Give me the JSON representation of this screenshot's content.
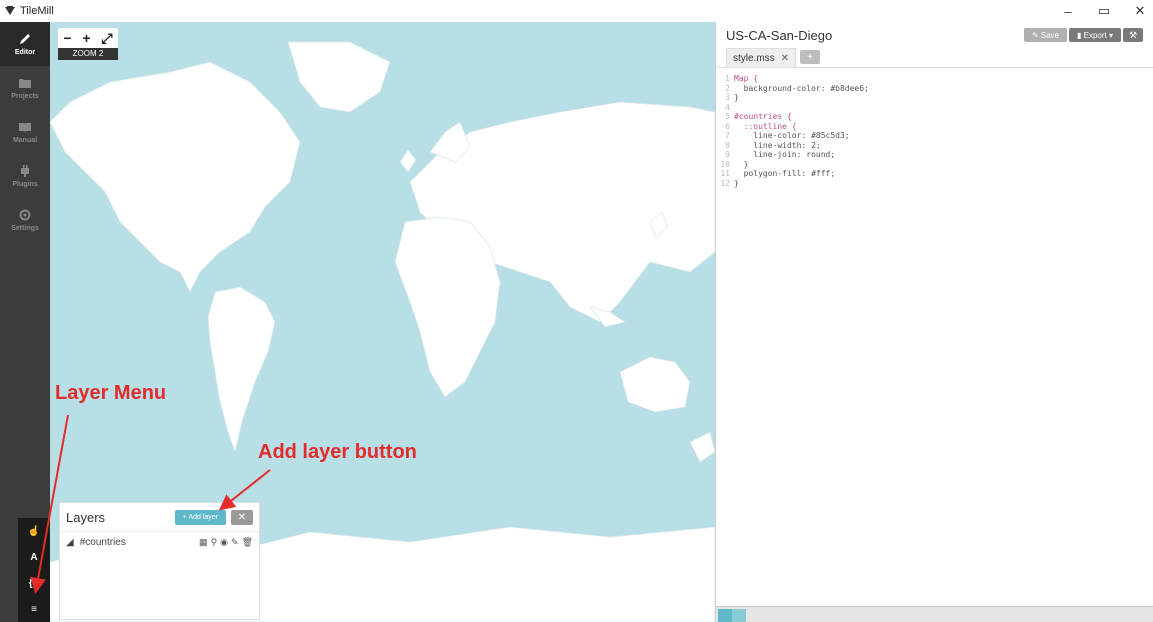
{
  "window": {
    "title": "TileMill",
    "controls": {
      "minimize": "–",
      "restore": "▭",
      "close": "✕"
    }
  },
  "sidebar": {
    "items": [
      {
        "label": "Editor",
        "icon": "pencil-icon",
        "active": true
      },
      {
        "label": "Projects",
        "icon": "folder-icon",
        "active": false
      },
      {
        "label": "Manual",
        "icon": "book-icon",
        "active": false
      },
      {
        "label": "Plugins",
        "icon": "plug-icon",
        "active": false
      },
      {
        "label": "Settings",
        "icon": "gear-icon",
        "active": false
      }
    ],
    "tools": [
      {
        "glyph": "☝",
        "icon": "hand-icon"
      },
      {
        "glyph": "A",
        "icon": "font-icon"
      },
      {
        "glyph": "{ }",
        "icon": "braces-icon"
      },
      {
        "glyph": "≡",
        "icon": "layers-icon"
      }
    ]
  },
  "map": {
    "zoom_label": "ZOOM 2",
    "zoom_in": "+",
    "zoom_out": "−",
    "fullscreen": "⤢",
    "background": "#b8dee6"
  },
  "annotations": {
    "layer_menu": "Layer Menu",
    "add_layer_button": "Add layer button",
    "color": "#e42b2b"
  },
  "layers_panel": {
    "title": "Layers",
    "add_label": "+ Add layer",
    "close": "✕",
    "layers": [
      {
        "name": "#countries"
      }
    ]
  },
  "editor": {
    "project_title": "US-CA-San-Diego",
    "save_label": "Save",
    "export_label": "Export",
    "tab": {
      "label": "style.mss",
      "close": "✕"
    },
    "tab_add": "+",
    "code_lines": [
      "Map {",
      "  background-color: #b8dee6;",
      "}",
      "",
      "#countries {",
      "  ::outline {",
      "    line-color: #85c5d3;",
      "    line-width: 2;",
      "    line-join: round;",
      "  }",
      "  polygon-fill: #fff;",
      "}"
    ]
  }
}
